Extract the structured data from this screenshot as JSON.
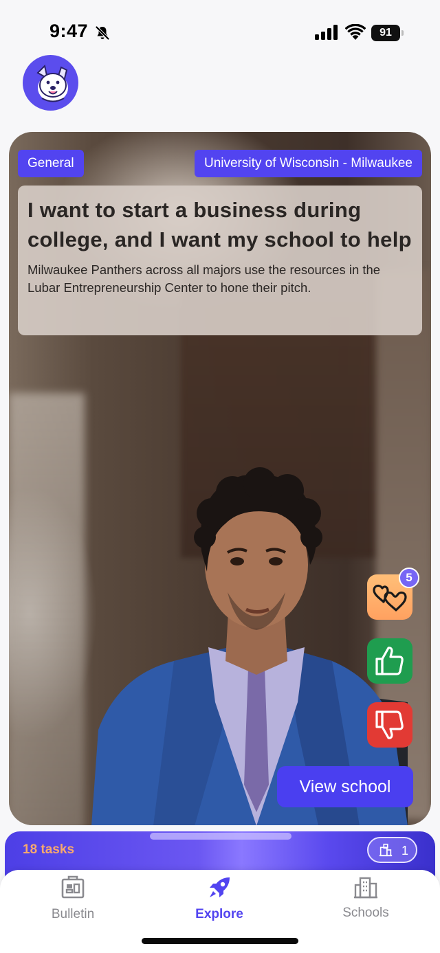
{
  "status_bar": {
    "time": "9:47",
    "battery": "91"
  },
  "card": {
    "category_tag": "General",
    "school_tag": "University of Wisconsin - Milwaukee",
    "headline": "I want to start a business during college, and I want my school to help",
    "description": "Milwaukee Panthers across all majors use the resources in the Lubar Entrepreneurship Center to hone their pitch.",
    "actions": {
      "favorite_count": "5",
      "view_school_label": "View school"
    }
  },
  "task_bar": {
    "label": "18 tasks",
    "school_count": "1"
  },
  "nav": {
    "items": [
      {
        "label": "Bulletin",
        "icon": "bulletin-board-icon"
      },
      {
        "label": "Explore",
        "icon": "rocket-icon",
        "active": true
      },
      {
        "label": "Schools",
        "icon": "buildings-icon"
      }
    ]
  },
  "colors": {
    "accent": "#5244f0",
    "like": "#1f9d4f",
    "dislike": "#e23a34",
    "favorite": "#ffb06c",
    "tasks_label": "#f7a86e"
  }
}
